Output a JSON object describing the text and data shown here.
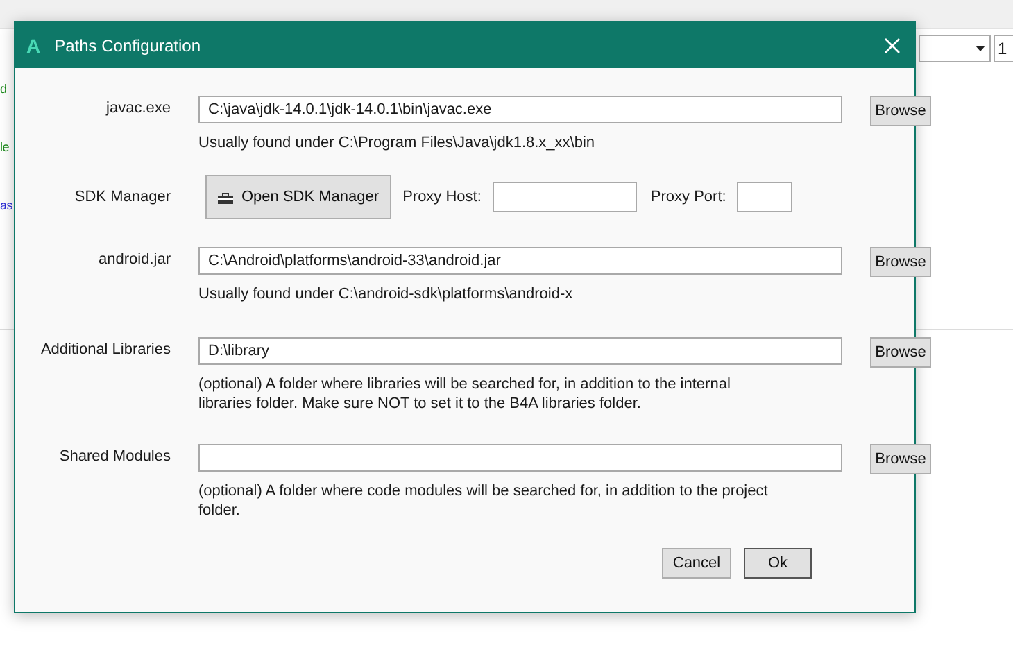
{
  "background": {
    "fragments": [
      {
        "text": "d",
        "color": "#1a8a1a"
      },
      {
        "text": "le",
        "color": "#1a8a1a"
      },
      {
        "text": "as",
        "color": "#2b2bd6"
      }
    ],
    "number_field": "1"
  },
  "dialog": {
    "title": "Paths Configuration",
    "app_letter": "A",
    "rows": [
      {
        "kind": "path",
        "label": "javac.exe",
        "value": "C:\\java\\jdk-14.0.1\\jdk-14.0.1\\bin\\javac.exe",
        "button": "Browse",
        "hint": "Usually found under C:\\Program Files\\Java\\jdk1.8.x_xx\\bin"
      },
      {
        "kind": "sdk",
        "label": "SDK Manager",
        "button": "Open SDK Manager",
        "host_label": "Proxy Host:",
        "port_label": "Proxy Port:"
      },
      {
        "kind": "path",
        "label": "android.jar",
        "value": "C:\\Android\\platforms\\android-33\\android.jar",
        "button": "Browse",
        "hint": "Usually found under C:\\android-sdk\\platforms\\android-x"
      },
      {
        "kind": "path",
        "label": "Additional Libraries",
        "value": "D:\\library",
        "button": "Browse",
        "hint": "(optional) A folder where libraries will be searched for, in addition to the internal libraries folder. Make sure NOT to set it to the B4A libraries folder."
      },
      {
        "kind": "path",
        "label": "Shared Modules",
        "value": "",
        "button": "Browse",
        "hint": "(optional) A folder where code modules will be searched for, in addition to the project folder."
      }
    ],
    "buttons": [
      "Cancel",
      "Ok"
    ]
  }
}
